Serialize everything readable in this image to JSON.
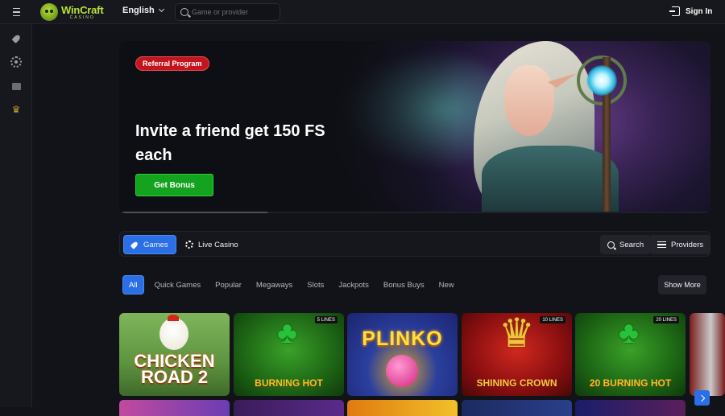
{
  "header": {
    "brand": {
      "name": "WinCraft",
      "sub": "CASINO"
    },
    "language": "English",
    "search_placeholder": "Game or provider",
    "signin_label": "Sign In"
  },
  "sidebar": {
    "icons": [
      "rocket-icon",
      "casino-chip-icon",
      "gift-icon",
      "crown-icon"
    ]
  },
  "banner": {
    "badge": "Referral Program",
    "headline": "Invite a friend get 150 FS each",
    "cta_label": "Get Bonus",
    "slide_progress": 0.25
  },
  "tabs": {
    "games": "Games",
    "live_casino": "Live Casino",
    "search": "Search",
    "providers": "Providers"
  },
  "filters": [
    "All",
    "Quick Games",
    "Popular",
    "Megaways",
    "Slots",
    "Jackpots",
    "Bonus Buys",
    "New"
  ],
  "show_more_label": "Show More",
  "games": [
    {
      "title": "CHICKEN ROAD 2",
      "lines": ""
    },
    {
      "title": "BURNING HOT",
      "lines": "5 LINES"
    },
    {
      "title": "PLINKO",
      "lines": ""
    },
    {
      "title": "SHINING CROWN",
      "lines": "10 LINES"
    },
    {
      "title": "20 BURNING HOT",
      "lines": "20 LINES"
    }
  ],
  "colors": {
    "accent_blue": "#2a6fe6",
    "cta_green": "#13a31f",
    "badge_red": "#c4151e",
    "brand_lime": "#b8e23d",
    "background": "#121318"
  }
}
